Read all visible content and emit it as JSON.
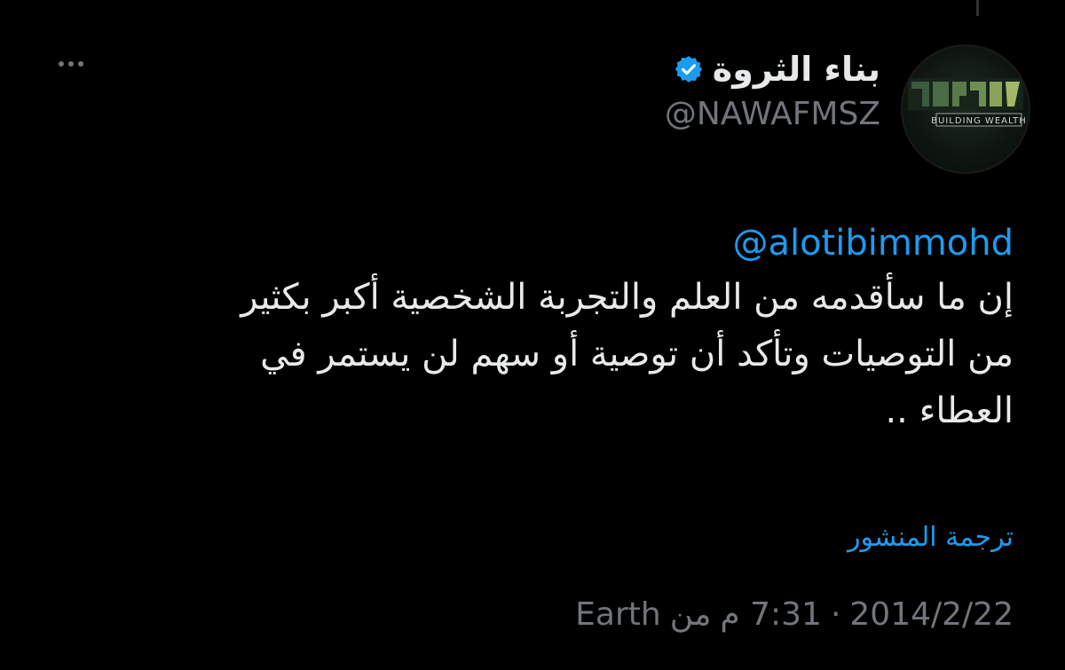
{
  "author": {
    "display_name": "بناء الثروة",
    "handle": "@NAWAFMSZ",
    "verified": true,
    "avatar_icon": "building-wealth-logo",
    "avatar_text": "BUILDING WEALTH"
  },
  "tweet": {
    "mention": "@alotibimmohd",
    "lines": [
      "إن ما سأقدمه من العلم والتجربة الشخصية أكبر بكثير",
      "من التوصيات وتأكد أن توصية أو سهم لن يستمر في",
      "العطاء .."
    ],
    "translate_label": "ترجمة المنشور"
  },
  "meta": {
    "date": "2014/2/22",
    "separator": "·",
    "time": "7:31 م",
    "source_prefix": "من",
    "source": "Earth"
  },
  "colors": {
    "background": "#000000",
    "text": "#e7e9ea",
    "secondary": "#71767b",
    "accent": "#1d9bf0"
  },
  "icons": {
    "more": "more-dots-icon",
    "verified": "verified-badge-icon"
  }
}
